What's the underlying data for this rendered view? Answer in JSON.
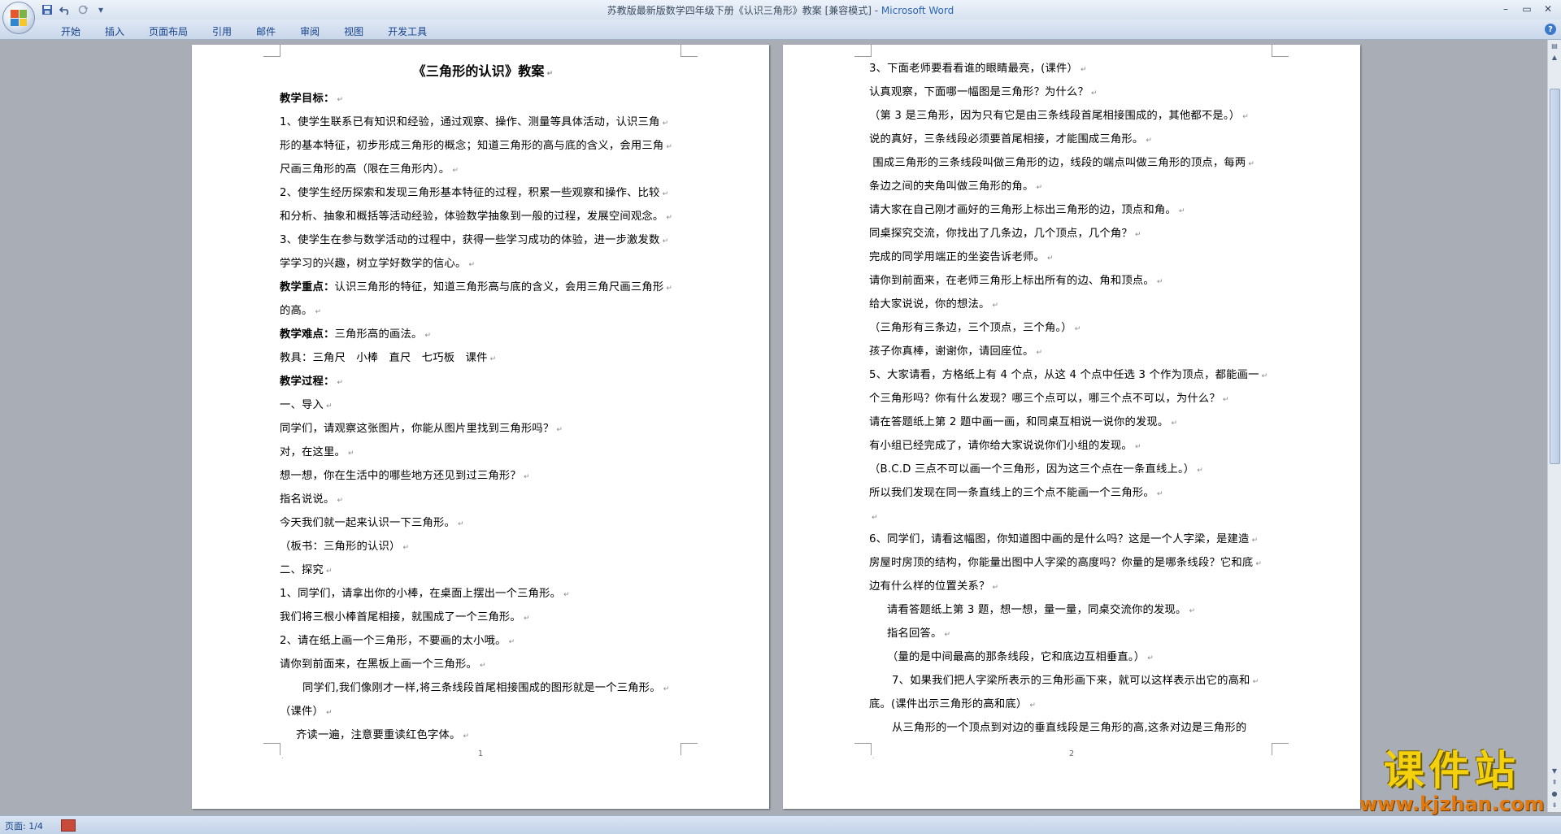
{
  "window": {
    "title_doc": "苏教版最新版数学四年级下册《认识三角形》教案 [兼容模式] - ",
    "title_app": "Microsoft Word",
    "minimize": "–",
    "restore": "▭",
    "close": "✕"
  },
  "qat": {
    "save_icon": "save-icon",
    "undo_icon": "undo-icon",
    "redo_icon": "redo-icon",
    "customize": "▾"
  },
  "ribbon": {
    "tabs": [
      "开始",
      "插入",
      "页面布局",
      "引用",
      "邮件",
      "审阅",
      "视图",
      "开发工具"
    ],
    "help": "?"
  },
  "page1": {
    "title": "《三角形的认识》教案",
    "lines": [
      {
        "bold": "教学目标：",
        "text": ""
      },
      {
        "bold": "",
        "text": "1、使学生联系已有知识和经验，通过观察、操作、测量等具体活动，认识三角"
      },
      {
        "bold": "",
        "text": "形的基本特征，初步形成三角形的概念；知道三角形的高与底的含义，会用三角"
      },
      {
        "bold": "",
        "text": "尺画三角形的高（限在三角形内）。"
      },
      {
        "bold": "",
        "text": "2、使学生经历探索和发现三角形基本特征的过程，积累一些观察和操作、比较"
      },
      {
        "bold": "",
        "text": "和分析、抽象和概括等活动经验，体验数学抽象到一般的过程，发展空间观念。"
      },
      {
        "bold": "",
        "text": "3、使学生在参与数学活动的过程中，获得一些学习成功的体验，进一步激发数"
      },
      {
        "bold": "",
        "text": "学学习的兴趣，树立学好数学的信心。"
      },
      {
        "bold": "教学重点：",
        "text": "认识三角形的特征，知道三角形高与底的含义，会用三角尺画三角形"
      },
      {
        "bold": "",
        "text": "的高。"
      },
      {
        "bold": "教学难点：",
        "text": "三角形高的画法。"
      },
      {
        "bold": "",
        "text": "教具：三角尺   小棒   直尺   七巧板   课件"
      },
      {
        "bold": "教学过程：",
        "text": ""
      },
      {
        "bold": "",
        "text": "一、导入"
      },
      {
        "bold": "",
        "text": "同学们，请观察这张图片，你能从图片里找到三角形吗？"
      },
      {
        "bold": "",
        "text": "对，在这里。"
      },
      {
        "bold": "",
        "text": "想一想，你在生活中的哪些地方还见到过三角形？"
      },
      {
        "bold": "",
        "text": "指名说说。"
      },
      {
        "bold": "",
        "text": "今天我们就一起来认识一下三角形。"
      },
      {
        "bold": "",
        "text": "（板书：三角形的认识）"
      },
      {
        "bold": "",
        "text": "二、探究"
      },
      {
        "bold": "",
        "text": "1、同学们，请拿出你的小棒，在桌面上摆出一个三角形。"
      },
      {
        "bold": "",
        "text": "我们将三根小棒首尾相接，就围成了一个三角形。"
      },
      {
        "bold": "",
        "text": "2、请在纸上画一个三角形，不要画的太小哦。"
      },
      {
        "bold": "",
        "text": "请你到前面来，在黑板上画一个三角形。"
      },
      {
        "bold": "",
        "text": "同学们,我们像刚才一样,将三条线段首尾相接围成的图形就是一个三角形。",
        "indent": "ind1"
      },
      {
        "bold": "",
        "text": "（课件）"
      },
      {
        "bold": "",
        "text": "齐读一遍，注意要重读红色字体。",
        "indent": "ind2"
      }
    ],
    "page_number": "1"
  },
  "page2": {
    "lines": [
      {
        "text": "3、下面老师要看看谁的眼睛最亮，(课件）"
      },
      {
        "text": "认真观察，下面哪一幅图是三角形？为什么？"
      },
      {
        "text": "（第 3 是三角形，因为只有它是由三条线段首尾相接围成的，其他都不是。）"
      },
      {
        "text": "说的真好，三条线段必须要首尾相接，才能围成三角形。"
      },
      {
        "text": " 围成三角形的三条线段叫做三角形的边，线段的端点叫做三角形的顶点，每两"
      },
      {
        "text": "条边之间的夹角叫做三角形的角。"
      },
      {
        "text": "请大家在自己刚才画好的三角形上标出三角形的边，顶点和角。"
      },
      {
        "text": "同桌探究交流，你找出了几条边，几个顶点，几个角？"
      },
      {
        "text": "完成的同学用端正的坐姿告诉老师。"
      },
      {
        "text": "请你到前面来，在老师三角形上标出所有的边、角和顶点。"
      },
      {
        "text": "给大家说说，你的想法。"
      },
      {
        "text": "（三角形有三条边，三个顶点，三个角。）"
      },
      {
        "text": "孩子你真棒，谢谢你，请回座位。"
      },
      {
        "text": "5、大家请看，方格纸上有 4 个点，从这 4 个点中任选 3 个作为顶点，都能画一"
      },
      {
        "text": "个三角形吗？你有什么发现？哪三个点可以，哪三个点不可以，为什么？"
      },
      {
        "text": "请在答题纸上第 2 题中画一画，和同桌互相说一说你的发现。"
      },
      {
        "text": "有小组已经完成了，请你给大家说说你们小组的发现。"
      },
      {
        "text": "（B.C.D 三点不可以画一个三角形，因为这三个点在一条直线上。）"
      },
      {
        "text": "所以我们发现在同一条直线上的三个点不能画一个三角形。"
      },
      {
        "text": "",
        "blank": true
      },
      {
        "text": "6、同学们，请看这幅图，你知道图中画的是什么吗？这是一个人字梁，是建造"
      },
      {
        "text": "房屋时房顶的结构，你能量出图中人字梁的高度吗？你量的是哪条线段？它和底"
      },
      {
        "text": "边有什么样的位置关系？"
      },
      {
        "text": "请看答题纸上第 3 题，想一想，量一量，同桌交流你的发现。",
        "indent": "ind3"
      },
      {
        "text": "指名回答。",
        "indent": "ind3"
      },
      {
        "text": "（量的是中间最高的那条线段，它和底边互相垂直。）",
        "indent": "ind3"
      },
      {
        "text": "7、如果我们把人字梁所表示的三角形画下来，就可以这样表示出它的高和",
        "indent": "ind1"
      },
      {
        "text": "底。(课件出示三角形的高和底）"
      },
      {
        "text": "从三角形的一个顶点到对边的垂直线段是三角形的高,这条对边是三角形的",
        "indent": "ind1",
        "noret": true
      }
    ],
    "page_number": "2"
  },
  "statusbar": {
    "page_info": "页面: 1/4"
  },
  "watermark": {
    "main": "课件站",
    "url": "www.kjzhan.com"
  },
  "colors": {
    "ribbon_text": "#15428b",
    "app_title": "#2a64b8",
    "doc_bg": "#a9adb5",
    "watermark_yellow": "#f4d10c"
  }
}
